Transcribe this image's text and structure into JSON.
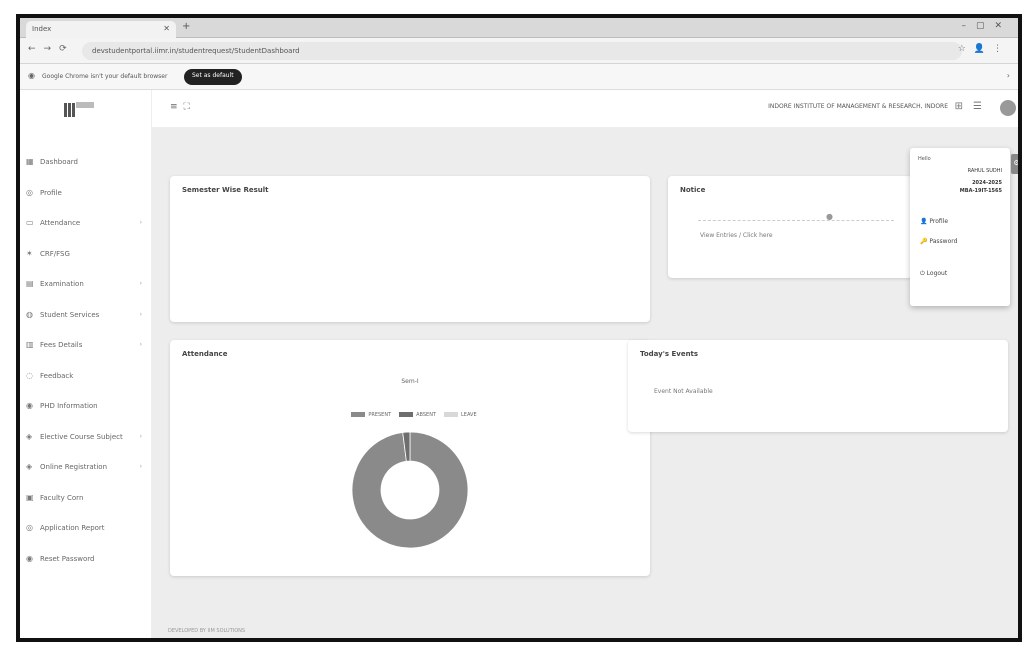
{
  "browser": {
    "tab_title": "Index",
    "url": "devstudentportal.iimr.in/studentrequest/StudentDashboard",
    "infobar_message": "Google Chrome isn't your default browser",
    "infobar_button": "Set as default"
  },
  "sidebar": {
    "items": [
      {
        "label": "Dashboard",
        "icon": "grid-icon",
        "expandable": false
      },
      {
        "label": "Profile",
        "icon": "user-icon",
        "expandable": false
      },
      {
        "label": "Attendance",
        "icon": "calendar-icon",
        "expandable": true
      },
      {
        "label": "CRF/FSG",
        "icon": "star-icon",
        "expandable": false
      },
      {
        "label": "Examination",
        "icon": "document-icon",
        "expandable": true
      },
      {
        "label": "Student Services",
        "icon": "service-icon",
        "expandable": true
      },
      {
        "label": "Fees Details",
        "icon": "receipt-icon",
        "expandable": true
      },
      {
        "label": "Feedback",
        "icon": "feedback-icon",
        "expandable": false
      },
      {
        "label": "PHD Information",
        "icon": "info-icon",
        "expandable": false
      },
      {
        "label": "Elective Course Subject",
        "icon": "book-icon",
        "expandable": true
      },
      {
        "label": "Online Registration",
        "icon": "register-icon",
        "expandable": true
      },
      {
        "label": "Faculty Corn",
        "icon": "faculty-icon",
        "expandable": false
      },
      {
        "label": "Application Report",
        "icon": "report-icon",
        "expandable": false
      },
      {
        "label": "Reset Password",
        "icon": "key-icon",
        "expandable": false
      }
    ]
  },
  "topbar": {
    "org_name": "INDORE INSTITUTE OF MANAGEMENT & RESEARCH, INDORE"
  },
  "cards": {
    "semester_result_title": "Semester Wise Result",
    "notice_title": "Notice",
    "notice_link": "View Entries / Click here",
    "attendance_title": "Attendance",
    "today_events_title": "Today's Events",
    "today_events_text": "Event Not Available"
  },
  "chart_data": {
    "type": "pie",
    "title": "Sem-I",
    "categories": [
      "PRESENT",
      "ABSENT",
      "LEAVE"
    ],
    "values": [
      98,
      2,
      0
    ],
    "colors": [
      "#8a8a8a",
      "#6e6e6e",
      "#d8d8d8"
    ],
    "donut": true
  },
  "footer": {
    "text": "DEVELOPED BY IIM SOLUTIONS"
  },
  "user_menu": {
    "hello": "Hello",
    "name": "RAHUL SUDHI",
    "year": "2024-2025",
    "enrollment": "MBA-19IT-1565",
    "items": [
      "Profile",
      "Password",
      "Logout"
    ]
  }
}
